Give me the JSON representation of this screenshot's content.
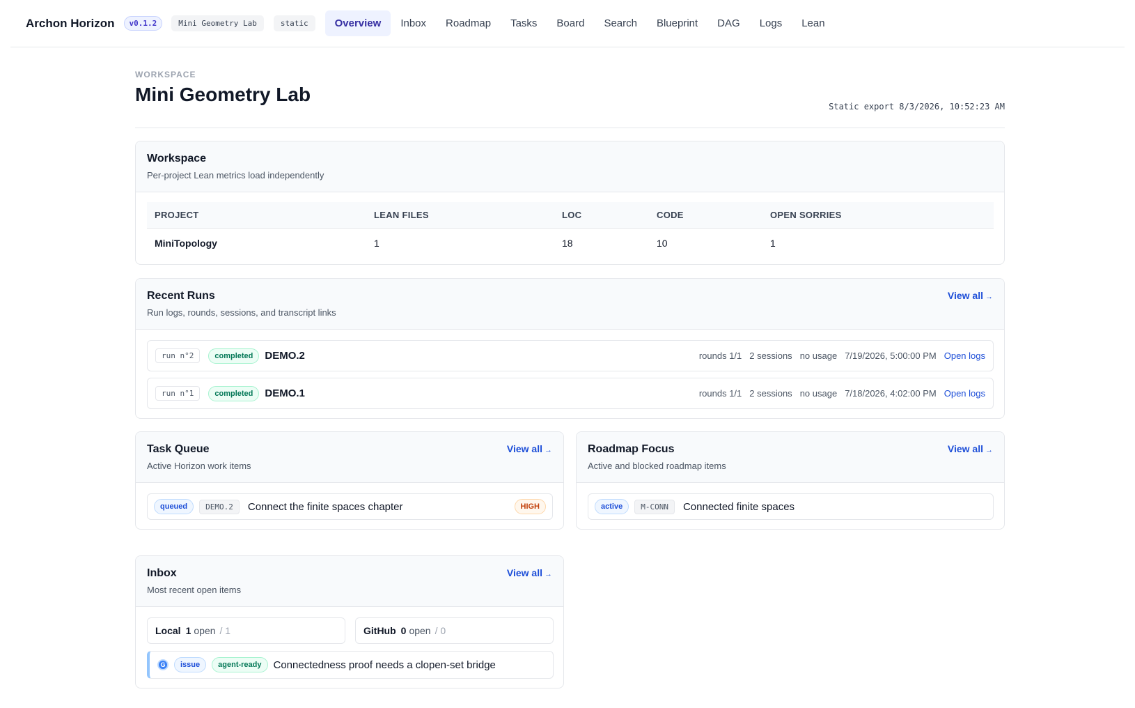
{
  "app": {
    "brand": "Archon Horizon",
    "version": "v0.1.2",
    "workspace_chip": "Mini Geometry Lab",
    "mode_chip": "static"
  },
  "nav": {
    "items": [
      "Overview",
      "Inbox",
      "Roadmap",
      "Tasks",
      "Board",
      "Search",
      "Blueprint",
      "DAG",
      "Logs",
      "Lean"
    ],
    "active": "Overview"
  },
  "header": {
    "eyebrow": "WORKSPACE",
    "title": "Mini Geometry Lab",
    "export_label": "Static export",
    "export_time": "8/3/2026, 10:52:23 AM"
  },
  "workspace": {
    "title": "Workspace",
    "subtitle": "Per-project Lean metrics load independently",
    "columns": [
      "PROJECT",
      "LEAN FILES",
      "LOC",
      "CODE",
      "OPEN SORRIES"
    ],
    "rows": [
      {
        "project": "MiniTopology",
        "lean_files": "1",
        "loc": "18",
        "code": "10",
        "open_sorries": "1"
      }
    ]
  },
  "recent_runs": {
    "title": "Recent Runs",
    "subtitle": "Run logs, rounds, sessions, and transcript links",
    "view_all": "View all",
    "arrow": "→",
    "runs": [
      {
        "id": "run n°2",
        "status": "completed",
        "name": "DEMO.2",
        "rounds": "rounds 1/1",
        "sessions": "2 sessions",
        "usage": "no usage",
        "time": "7/19/2026, 5:00:00 PM",
        "link": "Open logs"
      },
      {
        "id": "run n°1",
        "status": "completed",
        "name": "DEMO.1",
        "rounds": "rounds 1/1",
        "sessions": "2 sessions",
        "usage": "no usage",
        "time": "7/18/2026, 4:02:00 PM",
        "link": "Open logs"
      }
    ]
  },
  "task_queue": {
    "title": "Task Queue",
    "subtitle": "Active Horizon work items",
    "view_all": "View all",
    "arrow": "→",
    "items": [
      {
        "status": "queued",
        "ref": "DEMO.2",
        "text": "Connect the finite spaces chapter",
        "priority": "HIGH"
      }
    ]
  },
  "roadmap_focus": {
    "title": "Roadmap Focus",
    "subtitle": "Active and blocked roadmap items",
    "view_all": "View all",
    "arrow": "→",
    "items": [
      {
        "status": "active",
        "ref": "M-CONN",
        "text": "Connected finite spaces"
      }
    ]
  },
  "inbox": {
    "title": "Inbox",
    "subtitle": "Most recent open items",
    "view_all": "View all",
    "arrow": "→",
    "sources": [
      {
        "name": "Local",
        "open_count": "1",
        "open_label": "open",
        "total": "/ 1"
      },
      {
        "name": "GitHub",
        "open_count": "0",
        "open_label": "open",
        "total": "/ 0"
      }
    ],
    "items": [
      {
        "icon_letter": "G",
        "type": "issue",
        "label": "agent-ready",
        "text": "Connectedness proof needs a clopen-set bridge"
      }
    ]
  },
  "colors": {
    "accent": "#3730a3",
    "link": "#1d4ed8",
    "completed": "#047857",
    "priority_high": "#c2410c"
  }
}
